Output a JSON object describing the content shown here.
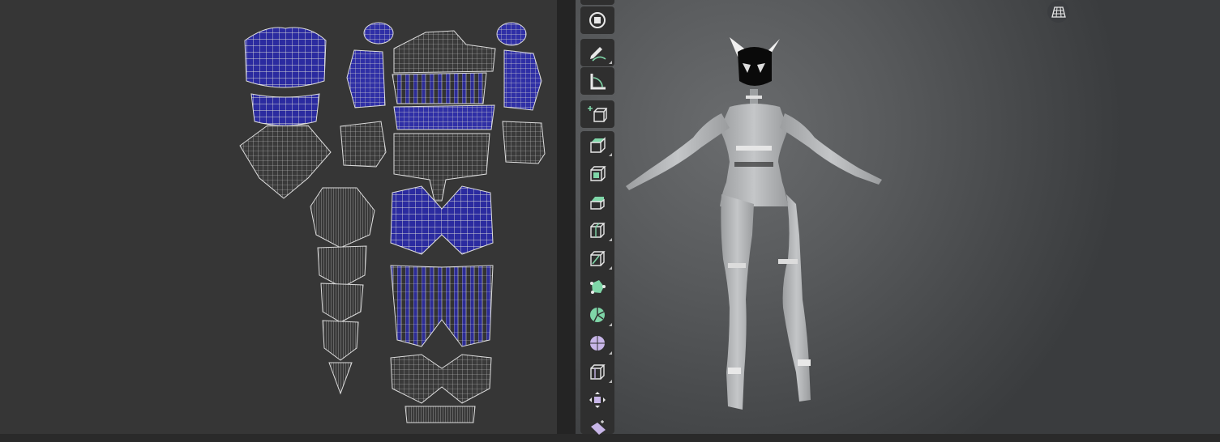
{
  "colors": {
    "uv_background": "#363636",
    "uv_wire": "#d0d0d0",
    "uv_fill_selected": "#2a2a9a",
    "viewport_bg": "#585a5c",
    "toolbar_bg": "#2f2f2f",
    "tool_icon_green": "#7fd6a8",
    "tool_icon_purple": "#c8b6e8",
    "tool_icon_white": "#e8e8e8",
    "model_skin": "#b6b8ba"
  },
  "toolbar": {
    "tools": [
      {
        "name": "select-tool",
        "icon": "target-square-icon"
      },
      {
        "name": "draw-tool",
        "icon": "pencil-curve-icon"
      },
      {
        "name": "measure-tool",
        "icon": "ruler-angle-icon"
      },
      {
        "name": "add-cube-tool",
        "icon": "add-cube-icon"
      },
      {
        "name": "extrude-region-tool",
        "icon": "extrude-icon"
      },
      {
        "name": "inset-faces-tool",
        "icon": "inset-icon"
      },
      {
        "name": "bevel-tool",
        "icon": "bevel-icon"
      },
      {
        "name": "loop-cut-tool",
        "icon": "loop-cut-icon"
      },
      {
        "name": "knife-tool",
        "icon": "knife-icon"
      },
      {
        "name": "poly-build-tool",
        "icon": "poly-build-icon"
      },
      {
        "name": "spin-tool",
        "icon": "spin-icon"
      },
      {
        "name": "smooth-tool",
        "icon": "smooth-sphere-icon"
      },
      {
        "name": "edge-slide-tool",
        "icon": "edge-slide-icon"
      },
      {
        "name": "shrink-fatten-tool",
        "icon": "shrink-fatten-icon"
      },
      {
        "name": "shear-tool",
        "icon": "shear-icon"
      }
    ]
  },
  "viewport": {
    "overlay_toggle_icon": "grid-perspective-icon"
  }
}
